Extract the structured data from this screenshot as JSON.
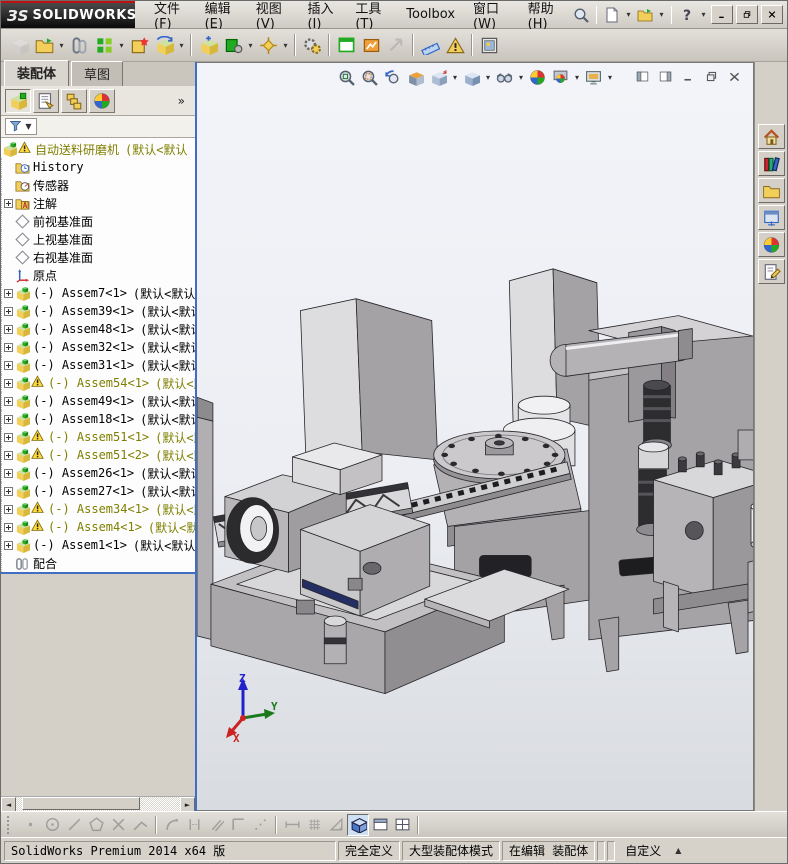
{
  "titlebar": {
    "logo_mark": "ЗS",
    "brand": "SOLIDWORKS",
    "menus": [
      "文件(F)",
      "编辑(E)",
      "视图(V)",
      "插入(I)",
      "工具(T)",
      "Toolbox",
      "窗口(W)",
      "帮助(H)"
    ],
    "quick_icons": [
      {
        "name": "search-icon"
      },
      {
        "name": "new-document-icon",
        "dropdown": true
      },
      {
        "name": "open-document-icon",
        "dropdown": true
      },
      {
        "name": "help-icon",
        "dropdown": true
      }
    ],
    "window_buttons": [
      "minimize",
      "restore",
      "close"
    ]
  },
  "toolbar": {
    "icons": [
      {
        "name": "insert-component",
        "disabled": true
      },
      {
        "name": "open-document",
        "dropdown": true
      },
      {
        "name": "mate"
      },
      {
        "name": "component-pattern",
        "dropdown": true
      },
      {
        "name": "smart-fasteners"
      },
      {
        "name": "rotate-component",
        "dropdown": true
      },
      {
        "name": "sep"
      },
      {
        "name": "move-component"
      },
      {
        "name": "large-assembly",
        "dropdown": true
      },
      {
        "name": "exploded-view",
        "dropdown": true
      },
      {
        "name": "sep"
      },
      {
        "name": "assembly-features"
      },
      {
        "name": "sep"
      },
      {
        "name": "new-window"
      },
      {
        "name": "motion-study"
      },
      {
        "name": "instant3d",
        "disabled": true
      },
      {
        "name": "sep"
      },
      {
        "name": "measure"
      },
      {
        "name": "interference-detection"
      },
      {
        "name": "sep"
      },
      {
        "name": "image-capture"
      }
    ]
  },
  "headsup": {
    "icons": [
      {
        "name": "zoom-fit"
      },
      {
        "name": "zoom-area"
      },
      {
        "name": "previous-view"
      },
      {
        "name": "section-view"
      },
      {
        "name": "view-orientation",
        "dropdown": true
      },
      {
        "name": "display-style",
        "dropdown": true
      },
      {
        "name": "hide-show-items",
        "dropdown": true
      },
      {
        "name": "edit-appearance"
      },
      {
        "name": "apply-scene",
        "dropdown": true
      },
      {
        "name": "view-settings",
        "dropdown": true
      }
    ],
    "doc_buttons": [
      "pane-left",
      "pane-right",
      "doc-minimize",
      "doc-restore",
      "doc-close"
    ]
  },
  "sidebar": {
    "tabs": [
      {
        "label": "装配体",
        "active": true
      },
      {
        "label": "草图",
        "active": false
      }
    ],
    "icon_tabs": [
      "featuremanager",
      "propertymanager",
      "configurationmanager",
      "displaymanager"
    ],
    "more_label": "»",
    "filter_icon": "filter-funnel",
    "tree": [
      {
        "icon": "assembly-root",
        "warning": true,
        "label": "自动送料研磨机",
        "suffix": "(默认<默认",
        "level": 0
      },
      {
        "icon": "history-folder",
        "label": "History",
        "level": 1
      },
      {
        "icon": "sensors-folder",
        "label": "传感器",
        "level": 1
      },
      {
        "icon": "annotations-folder",
        "label": "注解",
        "level": 1,
        "expand": true
      },
      {
        "icon": "plane",
        "label": "前视基准面",
        "level": 1
      },
      {
        "icon": "plane",
        "label": "上视基准面",
        "level": 1
      },
      {
        "icon": "plane",
        "label": "右视基准面",
        "level": 1
      },
      {
        "icon": "origin",
        "label": "原点",
        "level": 1
      },
      {
        "icon": "component",
        "label": "(-) Assem7<1>",
        "suffix": "(默认<默认_",
        "level": 1,
        "expand": true
      },
      {
        "icon": "component",
        "label": "(-) Assem39<1>",
        "suffix": "(默认<默认_",
        "level": 1,
        "expand": true
      },
      {
        "icon": "component",
        "label": "(-) Assem48<1>",
        "suffix": "(默认<默认_",
        "level": 1,
        "expand": true
      },
      {
        "icon": "component",
        "label": "(-) Assem32<1>",
        "suffix": "(默认<默认_",
        "level": 1,
        "expand": true
      },
      {
        "icon": "component",
        "label": "(-) Assem31<1>",
        "suffix": "(默认<默认_",
        "level": 1,
        "expand": true
      },
      {
        "icon": "component",
        "warning": true,
        "label": "(-) Assem54<1>",
        "suffix": "(默认<默",
        "level": 1,
        "expand": true
      },
      {
        "icon": "component",
        "label": "(-) Assem49<1>",
        "suffix": "(默认<默认_",
        "level": 1,
        "expand": true
      },
      {
        "icon": "component",
        "label": "(-) Assem18<1>",
        "suffix": "(默认<默认_",
        "level": 1,
        "expand": true
      },
      {
        "icon": "component",
        "warning": true,
        "label": "(-) Assem51<1>",
        "suffix": "(默认<默",
        "level": 1,
        "expand": true
      },
      {
        "icon": "component",
        "warning": true,
        "label": "(-) Assem51<2>",
        "suffix": "(默认<默",
        "level": 1,
        "expand": true
      },
      {
        "icon": "component",
        "label": "(-) Assem26<1>",
        "suffix": "(默认<默认_",
        "level": 1,
        "expand": true
      },
      {
        "icon": "component",
        "label": "(-) Assem27<1>",
        "suffix": "(默认<默认_",
        "level": 1,
        "expand": true
      },
      {
        "icon": "component",
        "warning": true,
        "label": "(-) Assem34<1>",
        "suffix": "(默认<默",
        "level": 1,
        "expand": true
      },
      {
        "icon": "component",
        "warning": true,
        "label": "(-) Assem4<1>",
        "suffix": "(默认<默认",
        "level": 1,
        "expand": true
      },
      {
        "icon": "component",
        "label": "(-) Assem1<1>",
        "suffix": "(默认<默认_",
        "level": 1,
        "expand": true
      },
      {
        "icon": "mates",
        "label": "配合",
        "level": 1
      }
    ]
  },
  "taskpane": {
    "icons": [
      "home",
      "design-library",
      "file-explorer",
      "view-palette",
      "appearances",
      "custom-properties"
    ]
  },
  "sketchbar": {
    "icons": [
      {
        "name": "sketch-point",
        "disabled": true
      },
      {
        "name": "sketch-circle",
        "disabled": true
      },
      {
        "name": "sketch-line",
        "disabled": true
      },
      {
        "name": "sketch-polygon",
        "disabled": true
      },
      {
        "name": "trim-entities",
        "disabled": true
      },
      {
        "name": "sketch-chamfer",
        "disabled": true
      },
      {
        "name": "sep"
      },
      {
        "name": "sketch-fillet",
        "disabled": true
      },
      {
        "name": "mirror-entities",
        "disabled": true
      },
      {
        "name": "offset-entities",
        "disabled": true
      },
      {
        "name": "corner-rectangle",
        "disabled": true
      },
      {
        "name": "construction-points",
        "disabled": true
      },
      {
        "name": "sep"
      },
      {
        "name": "smart-dimension",
        "disabled": true
      },
      {
        "name": "grid-snap",
        "disabled": true
      },
      {
        "name": "angle-snap",
        "disabled": true
      },
      {
        "name": "view-cube",
        "active": true
      },
      {
        "name": "single-view"
      },
      {
        "name": "split-view"
      },
      {
        "name": "sep"
      }
    ]
  },
  "statusbar": {
    "left": "SolidWorks Premium 2014 x64 版",
    "defined": "完全定义",
    "large_mode": "大型装配体模式",
    "editing": "在编辑 装配体",
    "custom": "自定义",
    "tag_icon": "tag-icon"
  },
  "triad": {
    "x": "X",
    "y": "Y",
    "z": "Z"
  },
  "colors": {
    "splitter_blue": "#3f6fc4",
    "warning_text": "#7f7f00",
    "viewport_top": "#f2f4f9",
    "viewport_bottom": "#d8dbe0",
    "model_gray": "#a8a5a9",
    "accent_navy": "#232e63"
  }
}
